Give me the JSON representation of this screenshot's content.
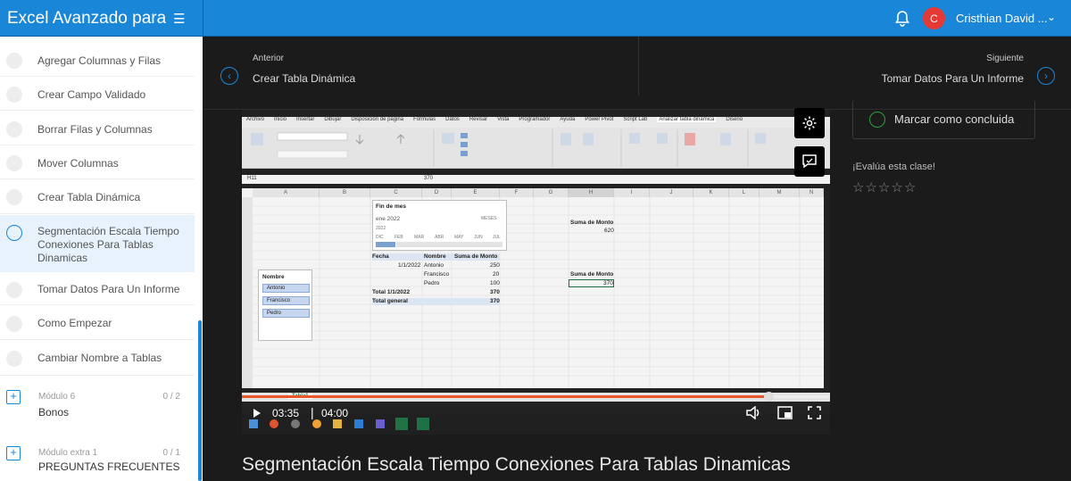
{
  "app": {
    "title": "Excel Avanzado para Ac"
  },
  "user": {
    "initial": "C",
    "name": "Cristhian David ..."
  },
  "sidebar": {
    "lessons": [
      {
        "label": "Agregar Columnas y Filas"
      },
      {
        "label": "Crear Campo Validado"
      },
      {
        "label": "Borrar Filas y Columnas"
      },
      {
        "label": "Mover Columnas"
      },
      {
        "label": "Crear Tabla Dinámica"
      },
      {
        "label": "Segmentación Escala Tiempo Conexiones Para Tablas Dinamicas"
      },
      {
        "label": "Tomar Datos Para Un Informe"
      },
      {
        "label": "Como Empezar"
      },
      {
        "label": "Cambiar Nombre a Tablas"
      }
    ],
    "modules": [
      {
        "sub": "Módulo 6",
        "count": "0 / 2",
        "name": "Bonos"
      },
      {
        "sub": "Módulo extra 1",
        "count": "0 / 1",
        "name": "PREGUNTAS FRECUENTES"
      }
    ]
  },
  "nav": {
    "prev_label": "Anterior",
    "prev_title": "Crear Tabla Dinámica",
    "next_label": "Siguiente",
    "next_title": "Tomar Datos Para Un Informe"
  },
  "video": {
    "current_time": "03:35",
    "duration": "04:00",
    "progress": 0.896,
    "ribbon_tabs": [
      "Archivo",
      "Inicio",
      "Insertar",
      "Dibujar",
      "Disposición de página",
      "Fórmulas",
      "Datos",
      "Revisar",
      "Vista",
      "Programador",
      "Ayuda",
      "Power Pivot",
      "Script Lab",
      "Analizar tabla dinámica",
      "Diseño"
    ],
    "cell_ref": "H11",
    "formula_value": "370",
    "columns": [
      "A",
      "B",
      "C",
      "D",
      "E",
      "F",
      "G",
      "H",
      "I",
      "J",
      "K",
      "L",
      "M",
      "N"
    ],
    "timeline": {
      "title": "Fin de mes",
      "range": "ene 2022",
      "unit": "MESES",
      "year": "2022",
      "months": [
        "DIC",
        "FEB",
        "MAR",
        "ABR",
        "MAY",
        "JUN",
        "JUL"
      ]
    },
    "slicer": {
      "title": "Nombre",
      "items": [
        "Antonio",
        "Francisco",
        "Pedro"
      ]
    },
    "pivot": {
      "headers": [
        "Fecha",
        "Nombre",
        "Suma de Monto"
      ],
      "date": "1/1/2022",
      "rows": [
        [
          "Antonio",
          "250"
        ],
        [
          "Francisco",
          "20"
        ],
        [
          "Pedro",
          "100"
        ]
      ],
      "total_row": [
        "Total 1/1/2022",
        "370"
      ],
      "grand_total": [
        "Total general",
        "370"
      ]
    },
    "summary1": {
      "label": "Suma de Monto",
      "value": "620"
    },
    "summary2": {
      "label": "Suma de Monto",
      "value": "370"
    },
    "sheet_tab": "Tabla1"
  },
  "right": {
    "complete_label": "Marcar como concluida",
    "rate_label": "¡Evalúa esta clase!",
    "stars": 5
  },
  "lesson_title": "Segmentación Escala Tiempo Conexiones Para Tablas Dinamicas"
}
